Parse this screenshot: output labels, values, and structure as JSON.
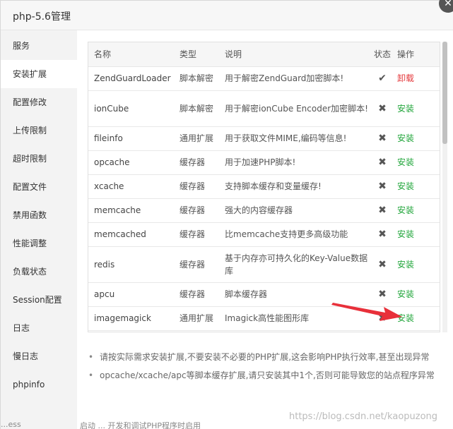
{
  "dialog": {
    "title": "php-5.6管理",
    "close_icon": "close-icon"
  },
  "sidebar": {
    "items": [
      {
        "label": "服务",
        "active": false
      },
      {
        "label": "安装扩展",
        "active": true
      },
      {
        "label": "配置修改",
        "active": false
      },
      {
        "label": "上传限制",
        "active": false
      },
      {
        "label": "超时限制",
        "active": false
      },
      {
        "label": "配置文件",
        "active": false
      },
      {
        "label": "禁用函数",
        "active": false
      },
      {
        "label": "性能调整",
        "active": false
      },
      {
        "label": "负载状态",
        "active": false
      },
      {
        "label": "Session配置",
        "active": false
      },
      {
        "label": "日志",
        "active": false
      },
      {
        "label": "慢日志",
        "active": false
      },
      {
        "label": "phpinfo",
        "active": false
      }
    ]
  },
  "table": {
    "headers": {
      "name": "名称",
      "type": "类型",
      "desc": "说明",
      "status": "状态",
      "op": "操作"
    },
    "rows": [
      {
        "name": "ZendGuardLoader",
        "type": "脚本解密",
        "desc": "用于解密ZendGuard加密脚本!",
        "installed": true,
        "status_icon": "check-icon",
        "status_glyph": "✔",
        "action": "卸载"
      },
      {
        "name": "ionCube",
        "type": "脚本解密",
        "desc": "用于解密ionCube Encoder加密脚本!",
        "installed": false,
        "status_icon": "cross-icon",
        "status_glyph": "✖",
        "action": "安装"
      },
      {
        "name": "fileinfo",
        "type": "通用扩展",
        "desc": "用于获取文件MIME,编码等信息!",
        "installed": false,
        "status_icon": "cross-icon",
        "status_glyph": "✖",
        "action": "安装"
      },
      {
        "name": "opcache",
        "type": "缓存器",
        "desc": "用于加速PHP脚本!",
        "installed": false,
        "status_icon": "cross-icon",
        "status_glyph": "✖",
        "action": "安装"
      },
      {
        "name": "xcache",
        "type": "缓存器",
        "desc": "支持脚本缓存和变量缓存!",
        "installed": false,
        "status_icon": "cross-icon",
        "status_glyph": "✖",
        "action": "安装"
      },
      {
        "name": "memcache",
        "type": "缓存器",
        "desc": "强大的内容缓存器",
        "installed": false,
        "status_icon": "cross-icon",
        "status_glyph": "✖",
        "action": "安装"
      },
      {
        "name": "memcached",
        "type": "缓存器",
        "desc": "比memcache支持更多高级功能",
        "installed": false,
        "status_icon": "cross-icon",
        "status_glyph": "✖",
        "action": "安装"
      },
      {
        "name": "redis",
        "type": "缓存器",
        "desc": "基于内存亦可持久化的Key-Value数据库",
        "installed": false,
        "status_icon": "cross-icon",
        "status_glyph": "✖",
        "action": "安装"
      },
      {
        "name": "apcu",
        "type": "缓存器",
        "desc": "脚本缓存器",
        "installed": false,
        "status_icon": "cross-icon",
        "status_glyph": "✖",
        "action": "安装"
      },
      {
        "name": "imagemagick",
        "type": "通用扩展",
        "desc": "Imagick高性能图形库",
        "installed": false,
        "status_icon": "cross-icon",
        "status_glyph": "✖",
        "action": "安装"
      }
    ]
  },
  "notes": [
    "请按实际需求安装扩展,不要安装不必要的PHP扩展,这会影响PHP执行效率,甚至出现异常",
    "opcache/xcache/apc等脚本缓存扩展,请只安装其中1个,否则可能导致您的站点程序异常"
  ],
  "bullet_glyph": "•",
  "colors": {
    "install": "#20a53a",
    "uninstall": "#e4393c",
    "arrow": "#e8303a"
  },
  "arrow_icon": "red-arrow-icon",
  "bottom_fragments": {
    "left": "...ess",
    "mid": "启动 ... 开发和调试PHP程序时启用"
  },
  "watermark": "https://blog.csdn.net/kaopuzong"
}
